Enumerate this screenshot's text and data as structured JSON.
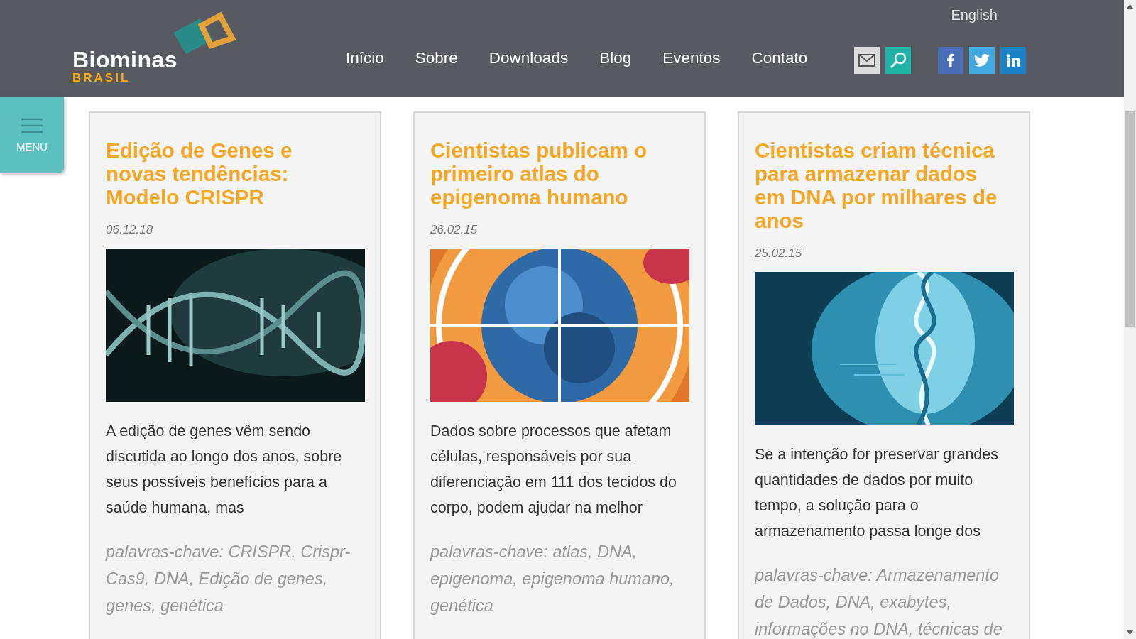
{
  "header": {
    "logo": {
      "name": "Biominas",
      "sub": "BRASIL"
    },
    "language": "English",
    "nav": [
      {
        "label": "Início"
      },
      {
        "label": "Sobre"
      },
      {
        "label": "Downloads"
      },
      {
        "label": "Blog"
      },
      {
        "label": "Eventos"
      },
      {
        "label": "Contato"
      }
    ],
    "tools": [
      {
        "kind": "mail"
      },
      {
        "kind": "search"
      }
    ],
    "social": [
      {
        "kind": "facebook",
        "color": "#4a6eb5"
      },
      {
        "kind": "twitter",
        "color": "#41a9e0"
      },
      {
        "kind": "linkedin",
        "color": "#1a84c7"
      }
    ]
  },
  "menu_button": {
    "label": "MENU"
  },
  "posts": [
    {
      "title": "Edição de Genes e novas tendências: Modelo CRISPR",
      "date": "06.12.18",
      "excerpt": "A edição de genes vêm sendo discutida ao longo dos anos, sobre seus possíveis benefícios para a saúde humana, mas",
      "keywords": "palavras-chave: CRISPR, Crispr-Cas9, DNA, Edição de genes, genes, genética"
    },
    {
      "title": "Cientistas publicam o primeiro atlas do epigenoma humano",
      "date": "26.02.15",
      "excerpt": "Dados sobre processos que afetam células, responsáveis por sua diferenciação em 111 dos tecidos do corpo, podem ajudar na melhor",
      "keywords": "palavras-chave: atlas, DNA, epigenoma, epigenoma humano, genética"
    },
    {
      "title": "Cientistas criam técnica para armazenar dados em DNA por milhares de anos",
      "date": "25.02.15",
      "excerpt": "Se a intenção for preservar grandes quantidades de dados por muito tempo, a solução para o armazenamento passa longe dos",
      "keywords": "palavras-chave: Armazenamento de Dados, DNA, exabytes, informações no DNA, técnicas de"
    }
  ]
}
